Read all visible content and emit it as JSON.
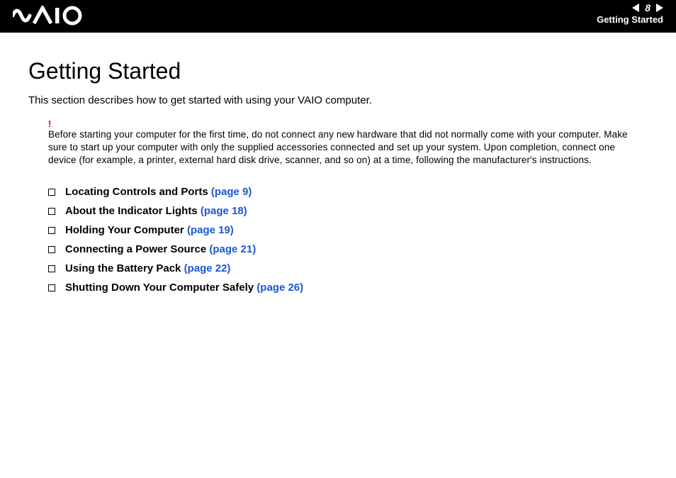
{
  "header": {
    "page_number": "8",
    "breadcrumb": "Getting Started"
  },
  "content": {
    "title": "Getting Started",
    "intro": "This section describes how to get started with using your VAIO computer.",
    "warning_mark": "!",
    "warning_text": "Before starting your computer for the first time, do not connect any new hardware that did not normally come with your computer. Make sure to start up your computer with only the supplied accessories connected and set up your system. Upon completion, connect one device (for example, a printer, external hard disk drive, scanner, and so on) at a time, following the manufacturer's instructions."
  },
  "toc": [
    {
      "label": "Locating Controls and Ports ",
      "page": "(page 9)"
    },
    {
      "label": "About the Indicator Lights ",
      "page": "(page 18)"
    },
    {
      "label": "Holding Your Computer ",
      "page": "(page 19)"
    },
    {
      "label": "Connecting a Power Source ",
      "page": "(page 21)"
    },
    {
      "label": "Using the Battery Pack ",
      "page": "(page 22)"
    },
    {
      "label": "Shutting Down Your Computer Safely ",
      "page": "(page 26)"
    }
  ]
}
